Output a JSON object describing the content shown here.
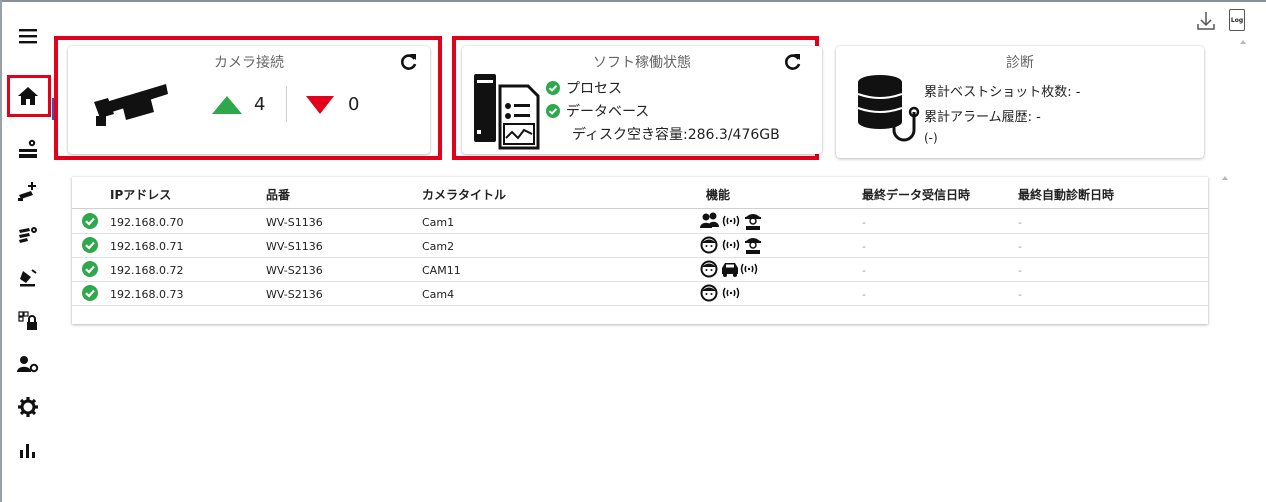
{
  "app": {
    "accent_red": "#e3001b",
    "check_green": "#2ea84a",
    "up_green": "#2ea84a",
    "down_red": "#e3001b"
  },
  "sidebar": {
    "items": [
      {
        "icon": "menu-icon"
      },
      {
        "icon": "home-icon",
        "active": true
      },
      {
        "icon": "camera-settings-icon"
      },
      {
        "icon": "add-camera-icon"
      },
      {
        "icon": "camera-group-settings-icon"
      },
      {
        "icon": "alarm-icon"
      },
      {
        "icon": "device-lock-icon"
      },
      {
        "icon": "user-settings-icon"
      },
      {
        "icon": "gear-icon"
      },
      {
        "icon": "statistics-icon"
      }
    ]
  },
  "toolbar": {
    "download_icon": "download-icon",
    "log_label": "Log"
  },
  "camera_connection": {
    "title": "カメラ接続",
    "up_count": "4",
    "down_count": "0"
  },
  "software_status": {
    "title": "ソフト稼働状態",
    "process_label": "プロセス",
    "database_label": "データベース",
    "disk_label": "ディスク空き容量:286.3/476GB"
  },
  "diagnosis": {
    "title": "診断",
    "best_shot_label": "累計ベストショット枚数: -",
    "alarm_history_label": "累計アラーム履歴: -",
    "extra": "(-)"
  },
  "camera_table": {
    "headers": {
      "ip": "IPアドレス",
      "model": "品番",
      "title": "カメラタイトル",
      "features": "機能",
      "last_data": "最終データ受信日時",
      "last_diag": "最終自動診断日時"
    },
    "rows": [
      {
        "ip": "192.168.0.70",
        "model": "WV-S1136",
        "title": "Cam1",
        "features": [
          "people-icon",
          "radio-waves-icon",
          "worker-icon"
        ],
        "last_data": "-",
        "last_diag": "-"
      },
      {
        "ip": "192.168.0.71",
        "model": "WV-S1136",
        "title": "Cam2",
        "features": [
          "face-icon",
          "radio-waves-icon",
          "worker-icon"
        ],
        "last_data": "-",
        "last_diag": "-"
      },
      {
        "ip": "192.168.0.72",
        "model": "WV-S2136",
        "title": "CAM11",
        "features": [
          "face-icon",
          "car-icon",
          "radio-waves-icon"
        ],
        "last_data": "-",
        "last_diag": "-"
      },
      {
        "ip": "192.168.0.73",
        "model": "WV-S2136",
        "title": "Cam4",
        "features": [
          "face-icon",
          "radio-waves-icon"
        ],
        "last_data": "-",
        "last_diag": "-"
      }
    ]
  }
}
